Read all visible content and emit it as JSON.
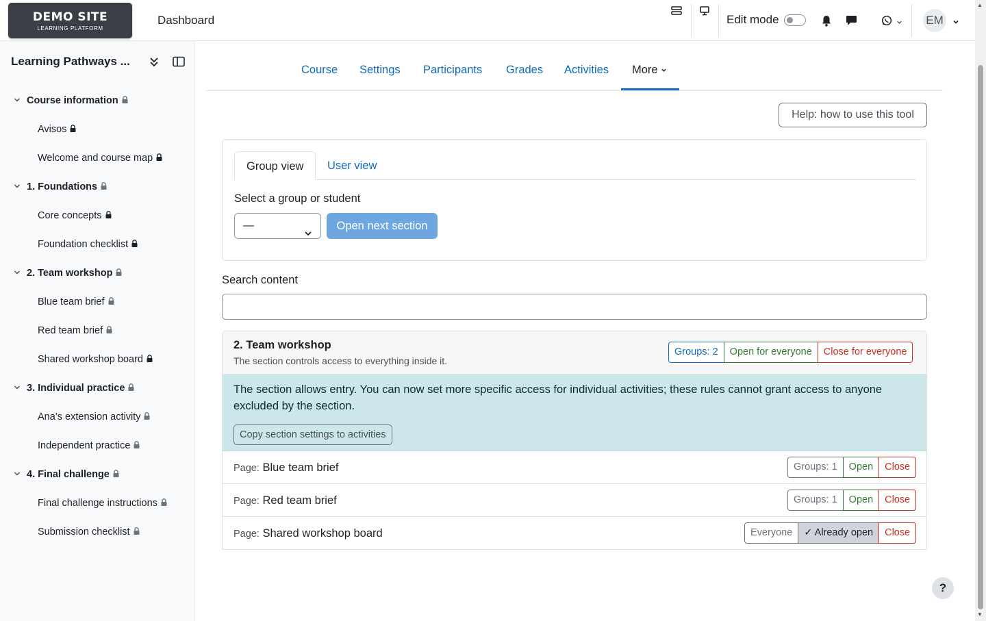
{
  "navbar": {
    "logo_line1": "DEMO SITE",
    "logo_line2": "LEARNING PLATFORM",
    "dashboard": "Dashboard",
    "edit_mode": "Edit mode",
    "avatar_initials": "EM"
  },
  "drawer": {
    "course_title": "Learning Pathways ...",
    "sections": [
      {
        "title": "Course information",
        "items": [
          "Avisos",
          "Welcome and course map"
        ]
      },
      {
        "title": "1. Foundations",
        "items": [
          "Core concepts",
          "Foundation checklist"
        ]
      },
      {
        "title": "2. Team workshop",
        "items": [
          "Blue team brief",
          "Red team brief",
          "Shared workshop board"
        ]
      },
      {
        "title": "3. Individual practice",
        "items": [
          "Ana’s extension activity",
          "Independent practice"
        ]
      },
      {
        "title": "4. Final challenge",
        "items": [
          "Final challenge instructions",
          "Submission checklist"
        ]
      }
    ]
  },
  "course_nav": {
    "tabs": [
      "Course",
      "Settings",
      "Participants",
      "Grades",
      "Activities",
      "More"
    ],
    "active": "More"
  },
  "help_button": "Help: how to use this tool",
  "view_card": {
    "tabs": [
      "Group view",
      "User view"
    ],
    "active_tab": "Group view",
    "select_label": "Select a group or student",
    "select_value": "—",
    "next_button": "Open next section"
  },
  "search": {
    "label": "Search content",
    "value": ""
  },
  "section": {
    "title": "2. Team workshop",
    "subtitle": "The section controls access to everything inside it.",
    "groups_badge": "Groups: 2",
    "open_all": "Open for everyone",
    "close_all": "Close for everyone",
    "alert": "The section allows entry. You can now set more specific access for individual activities; these rules cannot grant access to anyone excluded by the section.",
    "copy_button": "Copy section settings to activities",
    "activities": [
      {
        "type": "Page:",
        "name": "Blue team brief",
        "badge": "Groups: 1",
        "open": "Open",
        "close": "Close"
      },
      {
        "type": "Page:",
        "name": "Red team brief",
        "badge": "Groups: 1",
        "open": "Open",
        "close": "Close"
      },
      {
        "type": "Page:",
        "name": "Shared workshop board",
        "badge": "Everyone",
        "open": "✓ Already open",
        "close": "Close"
      }
    ]
  },
  "help_fab": "?",
  "colors": {
    "link": "#0f6cbf",
    "green": "#357a32",
    "red": "#ca3120",
    "alert_bg": "#cde6ea",
    "primary_disabled": "#6ea7e0",
    "drawer_bg": "#f8f9fa"
  }
}
